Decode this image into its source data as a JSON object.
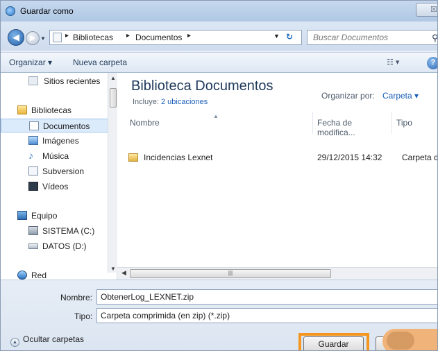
{
  "window": {
    "title": "Guardar como",
    "close_glyph": "☒"
  },
  "address": {
    "crumbs": [
      "Bibliotecas",
      "Documentos"
    ],
    "search_placeholder": "Buscar Documentos"
  },
  "toolbar": {
    "organize": "Organizar ▾",
    "new_folder": "Nueva carpeta"
  },
  "nav": {
    "recent": "Sitios recientes",
    "libraries": "Bibliotecas",
    "documents": "Documentos",
    "images": "Imágenes",
    "music": "Música",
    "subversion": "Subversion",
    "videos": "Vídeos",
    "computer": "Equipo",
    "drive_c": "SISTEMA (C:)",
    "drive_d": "DATOS (D:)",
    "network": "Red"
  },
  "main": {
    "title": "Biblioteca Documentos",
    "includes_label": "Incluye:",
    "includes_link": "2 ubicaciones",
    "arrange_label": "Organizar por:",
    "arrange_value": "Carpeta ▾",
    "columns": {
      "name": "Nombre",
      "date": "Fecha de modifica...",
      "type": "Tipo"
    },
    "rows": [
      {
        "name": "Incidencias Lexnet",
        "date": "29/12/2015 14:32",
        "type": "Carpeta d"
      }
    ]
  },
  "form": {
    "name_label": "Nombre:",
    "name_value": "ObtenerLog_LEXNET.zip",
    "type_label": "Tipo:",
    "type_value": "Carpeta comprimida (en zip) (*.zip)",
    "hide_folders": "Ocultar carpetas",
    "save": "Guardar"
  },
  "colors": {
    "highlight": "#f4961f",
    "link": "#1a5eb8",
    "title": "#1e395b"
  }
}
